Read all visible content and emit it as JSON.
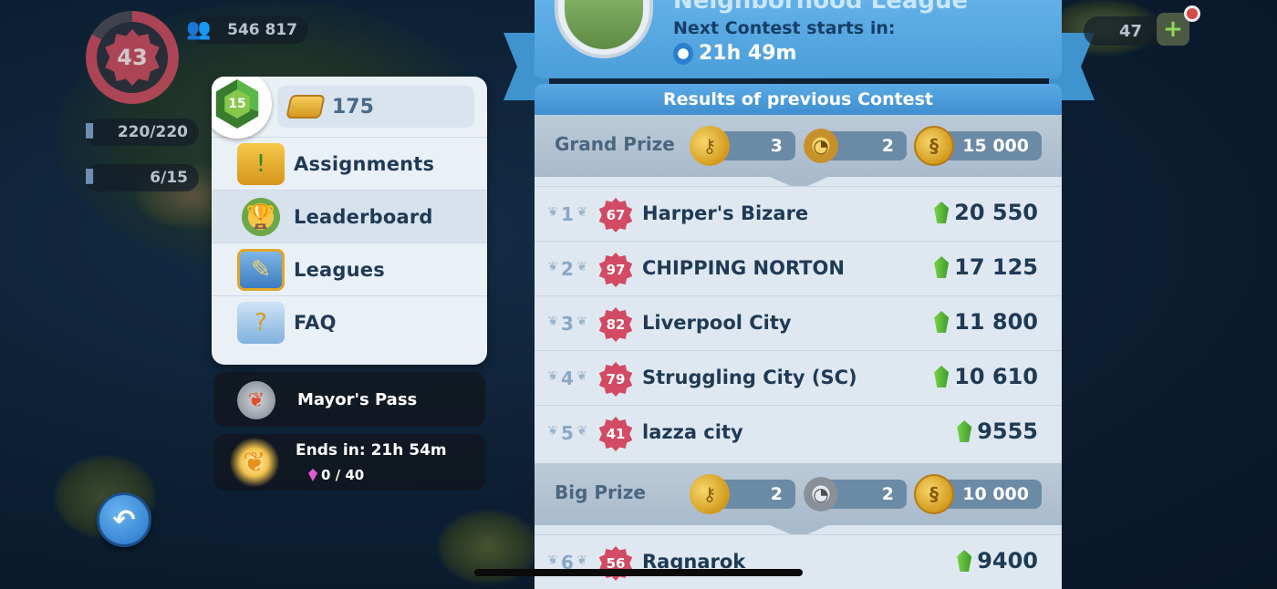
{
  "hud": {
    "player_level": "43",
    "population": "546 817",
    "storage": "220/220",
    "buildings": "6/15",
    "right_count": "47"
  },
  "menu": {
    "level": "15",
    "tokens": "175",
    "items": [
      {
        "label": "Assignments",
        "icon": "assignments-icon"
      },
      {
        "label": "Leaderboard",
        "icon": "trophy-icon"
      },
      {
        "label": "Leagues",
        "icon": "league-shield-icon"
      },
      {
        "label": "FAQ",
        "icon": "faq-book-icon"
      }
    ],
    "active_item": "Leaderboard"
  },
  "mayors_pass": {
    "title": "Mayor's Pass",
    "ends_label": "Ends in: 21h 54m",
    "progress": "0 / 40"
  },
  "contest": {
    "league_name": "Neighborhood League",
    "next_label": "Next Contest starts in:",
    "timer": "21h 49m",
    "results_title": "Results of previous Contest",
    "grand_prize": {
      "label": "Grand Prize",
      "keys": "3",
      "speedups": "2",
      "simoleons": "15 000"
    },
    "big_prize": {
      "label": "Big Prize",
      "keys": "2",
      "speedups": "2",
      "simoleons": "10 000"
    },
    "rows": [
      {
        "rank": "1",
        "level": "67",
        "city": "Harper's Bizare",
        "score": "20 550"
      },
      {
        "rank": "2",
        "level": "97",
        "city": "CHIPPING NORTON",
        "score": "17 125"
      },
      {
        "rank": "3",
        "level": "82",
        "city": "Liverpool City",
        "score": "11 800"
      },
      {
        "rank": "4",
        "level": "79",
        "city": "Struggling City (SC)",
        "score": "10 610"
      },
      {
        "rank": "5",
        "level": "41",
        "city": "lazza city",
        "score": "9555"
      },
      {
        "rank": "6",
        "level": "56",
        "city": "Ragnarok",
        "score": "9400"
      }
    ]
  },
  "colors": {
    "panel_blue": "#4b9ed9",
    "star_red": "#d24a63",
    "text_dark": "#1f3a55"
  }
}
